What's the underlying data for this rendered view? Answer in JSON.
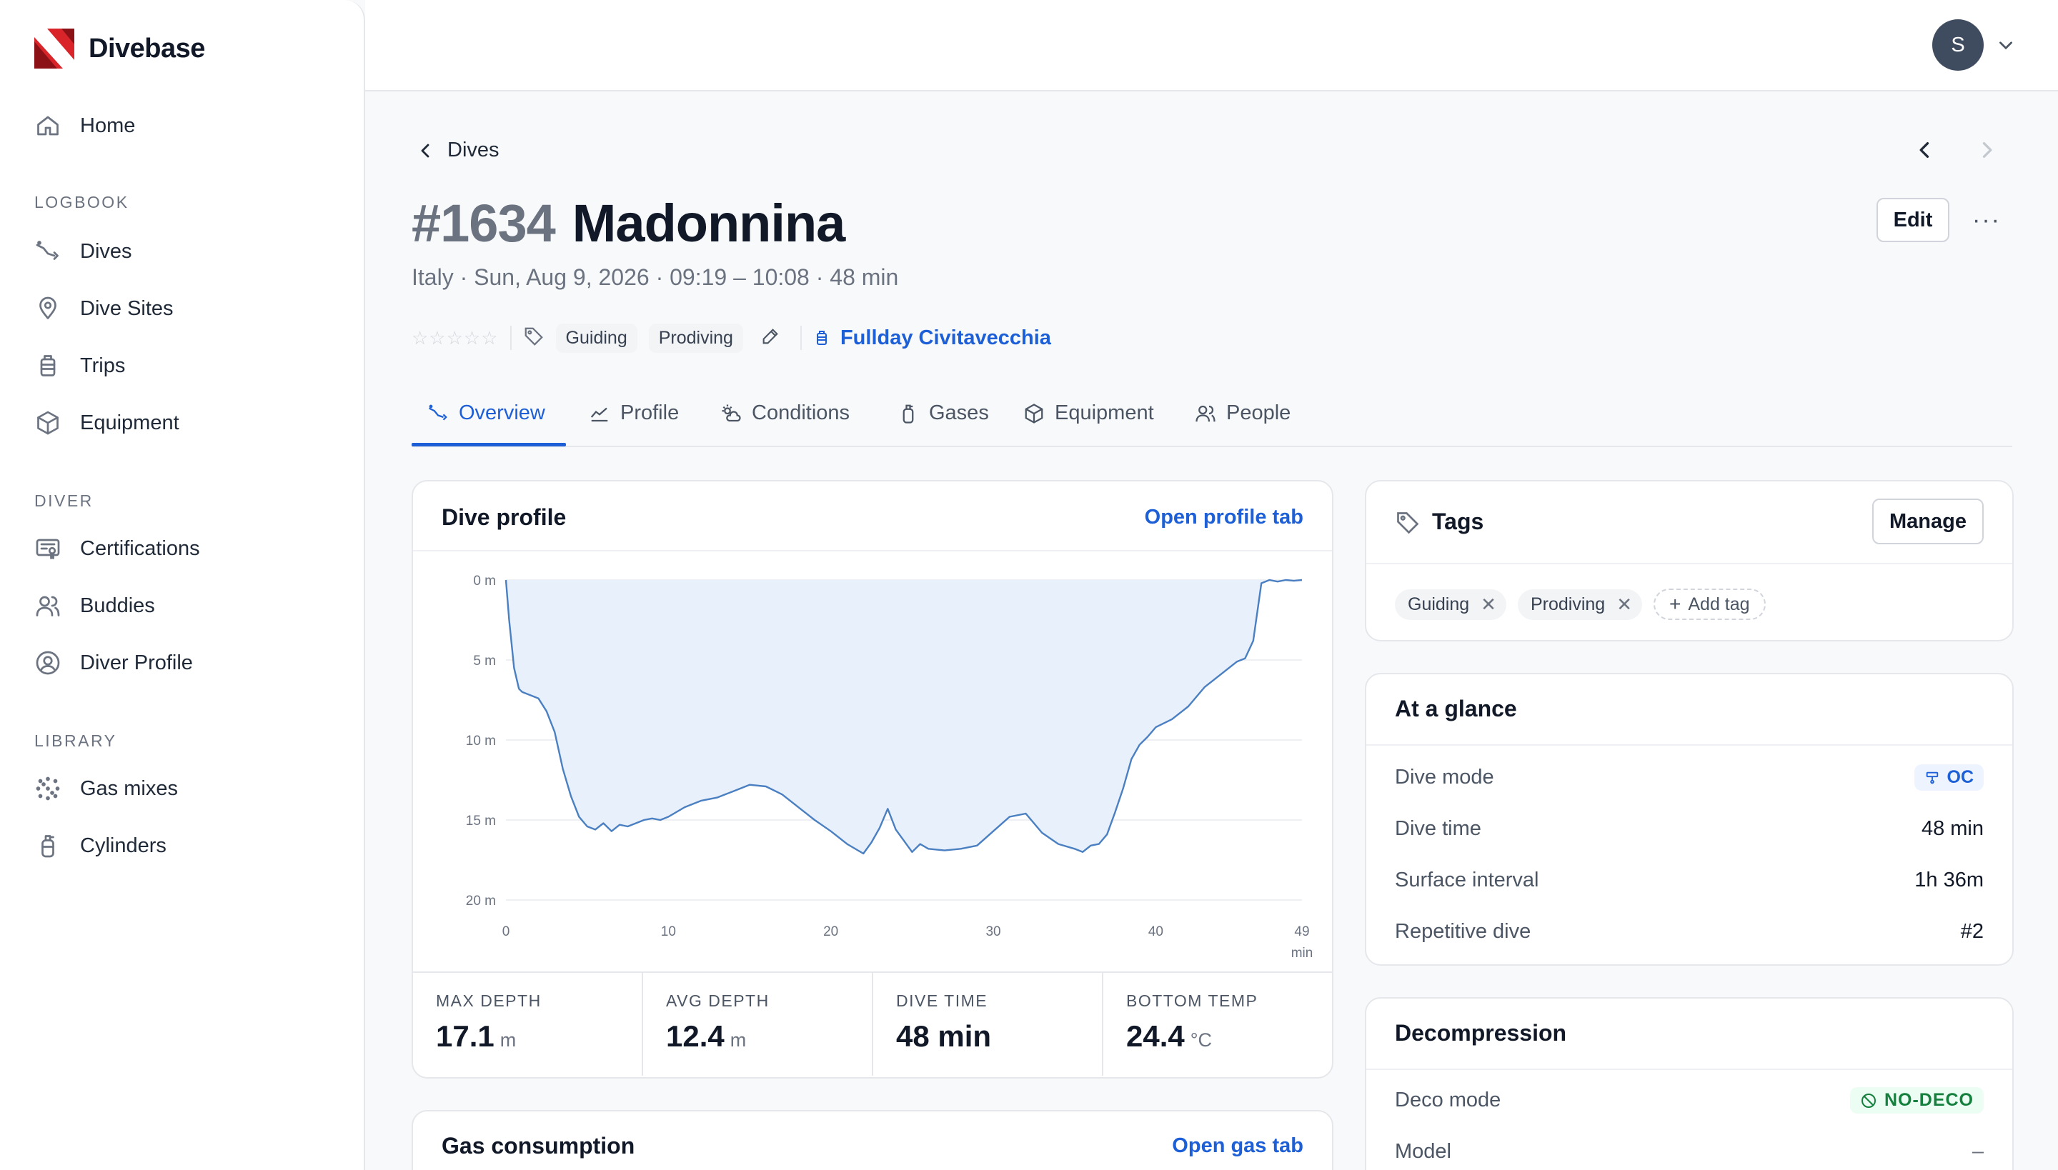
{
  "app": {
    "name": "Divebase"
  },
  "sidebar": {
    "home": "Home",
    "sections": [
      {
        "title": "LOGBOOK",
        "items": [
          "Dives",
          "Dive Sites",
          "Trips",
          "Equipment"
        ]
      },
      {
        "title": "DIVER",
        "items": [
          "Certifications",
          "Buddies",
          "Diver Profile"
        ]
      },
      {
        "title": "LIBRARY",
        "items": [
          "Gas mixes",
          "Cylinders"
        ]
      }
    ]
  },
  "user": {
    "initial": "S"
  },
  "breadcrumb": {
    "back_label": "Dives"
  },
  "dive": {
    "number": "#1634",
    "name": "Madonnina",
    "subtitle": "Italy · Sun, Aug 9, 2026 · 09:19 – 10:08 · 48 min",
    "rating": "☆☆☆☆☆",
    "tags": [
      "Guiding",
      "Prodiving"
    ],
    "trip": "Fullday Civitavecchia"
  },
  "actions": {
    "edit": "Edit",
    "more": "···"
  },
  "tabs": [
    "Overview",
    "Profile",
    "Conditions",
    "Gases",
    "Equipment",
    "People"
  ],
  "active_tab": "Overview",
  "profile_card": {
    "title": "Dive profile",
    "link": "Open profile tab",
    "stats": [
      {
        "label": "MAX DEPTH",
        "value": "17.1",
        "unit": "m"
      },
      {
        "label": "AVG DEPTH",
        "value": "12.4",
        "unit": "m"
      },
      {
        "label": "DIVE TIME",
        "value": "48 min",
        "unit": ""
      },
      {
        "label": "BOTTOM TEMP",
        "value": "24.4",
        "unit": "°C"
      }
    ]
  },
  "gas_card": {
    "title": "Gas consumption",
    "link": "Open gas tab"
  },
  "tags_card": {
    "title": "Tags",
    "manage": "Manage",
    "add_tag": "Add tag"
  },
  "glance_card": {
    "title": "At a glance",
    "rows": [
      {
        "label": "Dive mode",
        "value": "OC"
      },
      {
        "label": "Dive time",
        "value": "48 min"
      },
      {
        "label": "Surface interval",
        "value": "1h 36m"
      },
      {
        "label": "Repetitive dive",
        "value": "#2"
      }
    ]
  },
  "deco_card": {
    "title": "Decompression",
    "rows": [
      {
        "label": "Deco mode",
        "value": "NO-DECO"
      },
      {
        "label": "Model",
        "value": "–"
      }
    ]
  },
  "colors": {
    "accent": "#1d5fd6",
    "brand_red": "#d9252a",
    "profile_fill": "#e8f0fb",
    "profile_line": "#4a7fc1"
  },
  "chart_data": {
    "type": "area",
    "xlabel": "min",
    "ylabel": "",
    "x_ticks": [
      "0",
      "10",
      "20",
      "30",
      "40",
      "49"
    ],
    "y_ticks": [
      "0 m",
      "5 m",
      "10 m",
      "15 m",
      "20 m"
    ],
    "xlim": [
      0,
      49
    ],
    "ylim": [
      0,
      20
    ],
    "y_inverted": true,
    "grid": "horizontal",
    "series": [
      {
        "x": [
          0,
          0.2,
          0.5,
          0.8,
          1,
          1.5,
          2,
          2.5,
          3,
          3.5,
          4,
          4.5,
          5,
          5.5,
          6,
          6.5,
          7,
          7.5,
          8,
          8.5,
          9,
          9.5,
          10,
          11,
          12,
          13,
          14,
          15,
          16,
          17,
          18,
          19,
          20,
          21,
          22,
          22.5,
          23,
          23.5,
          24,
          24.5,
          25,
          25.5,
          26,
          27,
          28,
          29,
          30,
          31,
          32,
          33,
          34,
          35,
          35.5,
          36,
          36.5,
          37,
          37.5,
          38,
          38.5,
          39,
          39.5,
          40,
          41,
          42,
          43,
          44,
          45,
          45.5,
          46,
          46.5,
          47,
          47.5,
          48,
          48.5,
          49
        ],
        "y": [
          0,
          2.5,
          5.5,
          6.8,
          7.0,
          7.2,
          7.4,
          8.2,
          9.5,
          11.8,
          13.5,
          14.8,
          15.4,
          15.6,
          15.2,
          15.7,
          15.3,
          15.4,
          15.2,
          15.0,
          14.9,
          15.0,
          14.8,
          14.2,
          13.8,
          13.6,
          13.2,
          12.8,
          12.9,
          13.4,
          14.2,
          15.0,
          15.7,
          16.5,
          17.1,
          16.4,
          15.5,
          14.3,
          15.6,
          16.3,
          17.0,
          16.5,
          16.8,
          16.9,
          16.8,
          16.6,
          15.7,
          14.8,
          14.6,
          15.8,
          16.5,
          16.8,
          17.0,
          16.6,
          16.5,
          15.9,
          14.5,
          13.0,
          11.2,
          10.3,
          9.8,
          9.2,
          8.7,
          7.9,
          6.7,
          5.9,
          5.1,
          4.9,
          3.8,
          0.2,
          0,
          0.1,
          0,
          0.05,
          0
        ]
      }
    ]
  }
}
